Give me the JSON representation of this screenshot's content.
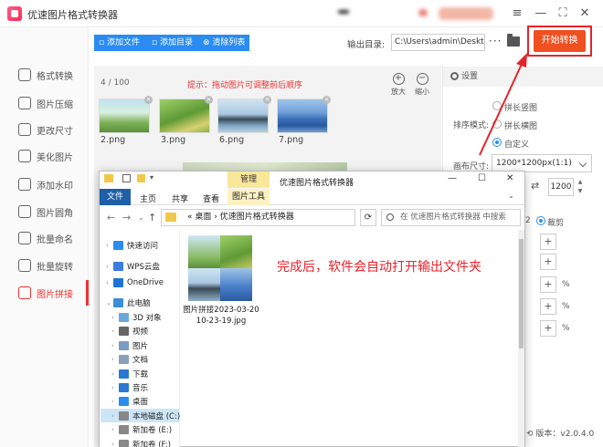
{
  "app": {
    "title": "优速图片格式转换器"
  },
  "sidebar": {
    "items": [
      {
        "label": "格式转换",
        "icon": "convert-icon",
        "active": false
      },
      {
        "label": "图片压缩",
        "icon": "compress-icon",
        "active": false
      },
      {
        "label": "更改尺寸",
        "icon": "resize-icon",
        "active": false
      },
      {
        "label": "美化图片",
        "icon": "beautify-icon",
        "active": false
      },
      {
        "label": "添加水印",
        "icon": "watermark-icon",
        "active": false
      },
      {
        "label": "图片圆角",
        "icon": "round-corner-icon",
        "active": false
      },
      {
        "label": "批量命名",
        "icon": "rename-icon",
        "active": false
      },
      {
        "label": "批量旋转",
        "icon": "rotate-icon",
        "active": false
      },
      {
        "label": "图片拼接",
        "icon": "stitch-icon",
        "active": true
      }
    ]
  },
  "toolbar": {
    "add_file": "添加文件",
    "add_dir": "添加目录",
    "clear": "清除列表",
    "output_label": "输出目录:",
    "output_path": "C:\\Users\\admin\\Deskto",
    "more": "···",
    "start": "开始转换"
  },
  "images": {
    "count": "4 / 100",
    "hint": "提示：拖动图片可调整前后顺序",
    "zoom_in": "放大",
    "zoom_out": "缩小",
    "files": [
      {
        "name": "2.png"
      },
      {
        "name": "3.png"
      },
      {
        "name": "6.png"
      },
      {
        "name": "7.png"
      }
    ]
  },
  "settings": {
    "title": "设置",
    "sort_label": "排序模式:",
    "sort_options": [
      "拼长竖图",
      "拼长横图",
      "自定义"
    ],
    "sort_selected": "自定义",
    "canvas_label": "画布尺寸:",
    "canvas_value": "1200*1200px(1:1)",
    "height_value": "1200",
    "partial_number": "2",
    "crop_label": "裁剪",
    "pct": "%",
    "version": "版本：v2.0.4.0"
  },
  "explorer": {
    "manage_tab": "管理",
    "title": "优速图片格式转换器",
    "tabs": [
      "文件",
      "主页",
      "共享",
      "查看"
    ],
    "picture_tools": "图片工具",
    "address": "«  桌面  ›  优速图片格式转换器",
    "search_placeholder": "在 优速图片格式转换器 中搜索",
    "tree": [
      {
        "label": "快速访问",
        "icon": "star-icon",
        "color": "#2a8cf0",
        "indent": 0
      },
      {
        "label": "WPS云盘",
        "icon": "cloud-icon",
        "color": "#3b7de0",
        "indent": 0
      },
      {
        "label": "OneDrive",
        "icon": "onedrive-icon",
        "color": "#1e73d8",
        "indent": 0
      },
      {
        "label": "此电脑",
        "icon": "pc-icon",
        "color": "#3a8fd8",
        "indent": 0
      },
      {
        "label": "3D 对象",
        "icon": "3d-icon",
        "color": "#6aa9e0",
        "indent": 1
      },
      {
        "label": "视频",
        "icon": "video-icon",
        "color": "#666666",
        "indent": 1
      },
      {
        "label": "图片",
        "icon": "picture-icon",
        "color": "#7a9cc0",
        "indent": 1
      },
      {
        "label": "文档",
        "icon": "document-icon",
        "color": "#8aa0b8",
        "indent": 1
      },
      {
        "label": "下载",
        "icon": "download-icon",
        "color": "#2a78d0",
        "indent": 1
      },
      {
        "label": "音乐",
        "icon": "music-icon",
        "color": "#2a78d0",
        "indent": 1
      },
      {
        "label": "桌面",
        "icon": "desktop-icon",
        "color": "#2a8cf0",
        "indent": 1
      },
      {
        "label": "本地磁盘 (C:)",
        "icon": "disk-icon",
        "color": "#888888",
        "indent": 1
      },
      {
        "label": "新加卷 (E:)",
        "icon": "disk-icon",
        "color": "#888888",
        "indent": 1
      },
      {
        "label": "新加卷 (F:)",
        "icon": "disk-icon",
        "color": "#888888",
        "indent": 1
      }
    ],
    "file_name": "图片拼接2023-03-20 10-23-19.jpg"
  },
  "annotation": "完成后，软件会自动打开输出文件夹",
  "colors": {
    "accent": "#2a8cf0",
    "start": "#f04f1f",
    "highlight": "#e8232a"
  }
}
